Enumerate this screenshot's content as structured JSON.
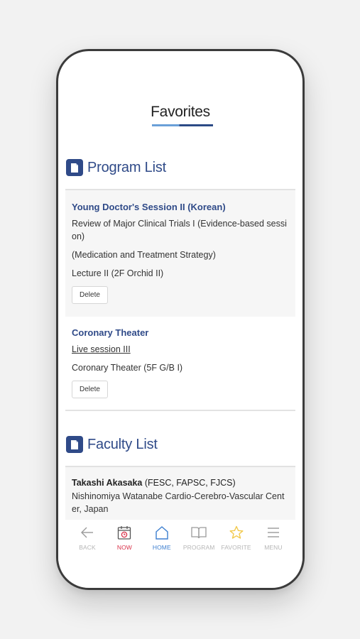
{
  "page": {
    "title": "Favorites"
  },
  "program_section": {
    "heading": "Program List",
    "items": [
      {
        "title": "Young Doctor's Session II (Korean)",
        "line1a": "Review of Major Clinical Trials I (Evidence-based sessi",
        "line1b": "on)",
        "line2": "(Medication and Treatment Strategy)",
        "location": "Lecture II (2F Orchid II)",
        "delete_label": "Delete"
      },
      {
        "title": "Coronary Theater",
        "line1": "Live session III",
        "location": "Coronary Theater (5F G/B I)",
        "delete_label": "Delete"
      }
    ]
  },
  "faculty_section": {
    "heading": "Faculty List",
    "items": [
      {
        "name": "Takashi Akasaka",
        "credentials": " (FESC, FAPSC, FJCS)",
        "affiliation_a": "Nishinomiya Watanabe Cardio-Cerebro-Vascular Cent",
        "affiliation_b": "er, Japan"
      }
    ]
  },
  "tabbar": {
    "back": "BACK",
    "now": "NOW",
    "home": "HOME",
    "program": "PROGRAM",
    "favorite": "FAVORITE",
    "menu": "MENU"
  },
  "colors": {
    "accent": "#2f4a88",
    "now": "#d9324a",
    "home": "#3d7fd0",
    "star": "#f2c94c"
  },
  "icons": [
    "document-icon",
    "back-arrow-icon",
    "calendar-icon",
    "home-icon",
    "book-icon",
    "star-icon",
    "menu-icon"
  ]
}
